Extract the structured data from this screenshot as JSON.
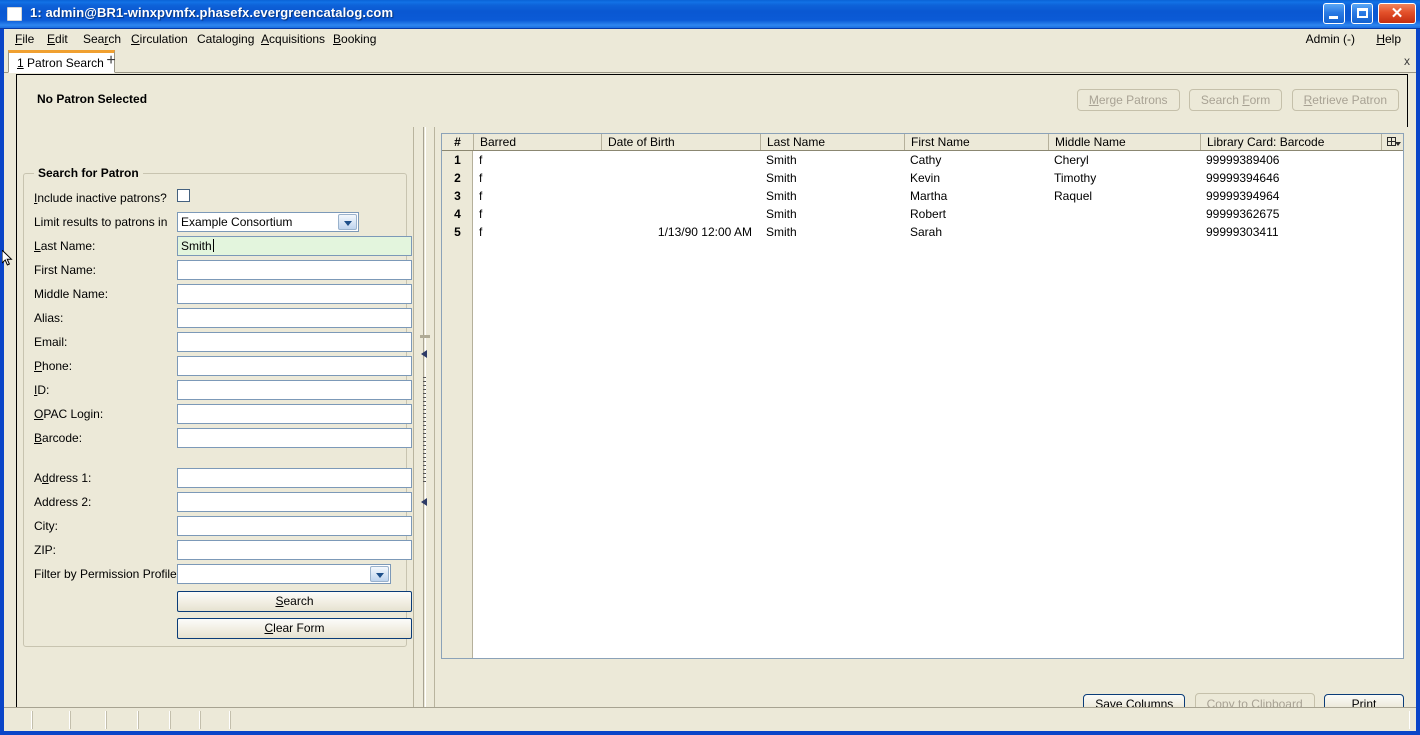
{
  "window": {
    "title": "1: admin@BR1-winxpvmfx.phasefx.evergreencatalog.com",
    "minimize_label": "",
    "maximize_label": "",
    "close_label": "✕"
  },
  "menubar": {
    "items": [
      {
        "label": "File",
        "mnemonic": "F"
      },
      {
        "label": "Edit",
        "mnemonic": "E"
      },
      {
        "label": "Search",
        "mnemonic": "r"
      },
      {
        "label": "Circulation",
        "mnemonic": "C"
      },
      {
        "label": "Cataloging",
        "mnemonic": "g"
      },
      {
        "label": "Acquisitions",
        "mnemonic": "A"
      },
      {
        "label": "Booking",
        "mnemonic": "B"
      }
    ],
    "right": [
      {
        "label": "Admin (-)"
      },
      {
        "label": "Help",
        "mnemonic": "H"
      }
    ]
  },
  "tabs": {
    "active": {
      "number": "1",
      "label": "Patron Search"
    },
    "new_tab_label": "+",
    "close_label": "x"
  },
  "patron_band": {
    "title": "No Patron Selected",
    "buttons": [
      {
        "label": "Merge Patrons",
        "mnemonic": "M",
        "enabled": false
      },
      {
        "label": "Search Form",
        "mnemonic": "F",
        "enabled": false
      },
      {
        "label": "Retrieve Patron",
        "mnemonic": "R",
        "enabled": false
      }
    ]
  },
  "search_form": {
    "legend": "Search for Patron",
    "include_inactive": {
      "label": "Include inactive patrons?",
      "mnemonic": "I",
      "checked": false
    },
    "limit_results": {
      "label": "Limit results to patrons in",
      "value": "Example Consortium"
    },
    "fields": [
      {
        "label": "Last Name:",
        "mnemonic": "L",
        "value": "Smith",
        "focused": true
      },
      {
        "label": "First Name:",
        "mnemonic": "",
        "value": "",
        "focused": false
      },
      {
        "label": "Middle Name:",
        "mnemonic": "",
        "value": "",
        "focused": false
      },
      {
        "label": "Alias:",
        "mnemonic": "",
        "value": "",
        "focused": false
      },
      {
        "label": "Email:",
        "mnemonic": "",
        "value": "",
        "focused": false
      },
      {
        "label": "Phone:",
        "mnemonic": "P",
        "value": "",
        "focused": false
      },
      {
        "label": "ID:",
        "mnemonic": "I",
        "value": "",
        "focused": false
      },
      {
        "label": "OPAC Login:",
        "mnemonic": "O",
        "value": "",
        "focused": false
      },
      {
        "label": "Barcode:",
        "mnemonic": "B",
        "value": "",
        "focused": false
      }
    ],
    "address_fields": [
      {
        "label": "Address 1:",
        "mnemonic": "d",
        "value": ""
      },
      {
        "label": "Address 2:",
        "mnemonic": "",
        "value": ""
      },
      {
        "label": "City:",
        "mnemonic": "",
        "value": ""
      },
      {
        "label": "ZIP:",
        "mnemonic": "",
        "value": ""
      }
    ],
    "permission_profile": {
      "label": "Filter by Permission Profile:",
      "value": ""
    },
    "search_button": {
      "label": "Search",
      "mnemonic": "S"
    },
    "clear_button": {
      "label": "Clear Form",
      "mnemonic": "C"
    }
  },
  "results": {
    "columns": [
      {
        "key": "num",
        "label": "#"
      },
      {
        "key": "barred",
        "label": "Barred"
      },
      {
        "key": "dob",
        "label": "Date of Birth"
      },
      {
        "key": "last",
        "label": "Last Name"
      },
      {
        "key": "first",
        "label": "First Name"
      },
      {
        "key": "middle",
        "label": "Middle Name"
      },
      {
        "key": "card",
        "label": "Library Card: Barcode"
      }
    ],
    "column_picker_icon": "column-picker-icon",
    "rows": [
      {
        "num": "1",
        "barred": "f",
        "dob": "",
        "last": "Smith",
        "first": "Cathy",
        "middle": "Cheryl",
        "card": "99999389406"
      },
      {
        "num": "2",
        "barred": "f",
        "dob": "",
        "last": "Smith",
        "first": "Kevin",
        "middle": "Timothy",
        "card": "99999394646"
      },
      {
        "num": "3",
        "barred": "f",
        "dob": "",
        "last": "Smith",
        "first": "Martha",
        "middle": "Raquel",
        "card": "99999394964"
      },
      {
        "num": "4",
        "barred": "f",
        "dob": "",
        "last": "Smith",
        "first": "Robert",
        "middle": "",
        "card": "99999362675"
      },
      {
        "num": "5",
        "barred": "f",
        "dob": "1/13/90 12:00 AM",
        "last": "Smith",
        "first": "Sarah",
        "middle": "",
        "card": "99999303411"
      }
    ],
    "footer_buttons": [
      {
        "label": "Save Columns",
        "enabled": true
      },
      {
        "label": "Copy to Clipboard",
        "enabled": false
      },
      {
        "label": "Print",
        "enabled": true
      }
    ]
  },
  "statusbar": {
    "segments": [
      "",
      "",
      "",
      "",
      "",
      "",
      "",
      ""
    ]
  },
  "colors": {
    "window_chrome": "#ece9d8",
    "titlebar_blue": "#0a58d2",
    "tab_accent": "#f0a030",
    "focused_field": "#e3f5dd",
    "button_border": "#0a3c78",
    "grid_border": "#8ba2b8"
  }
}
